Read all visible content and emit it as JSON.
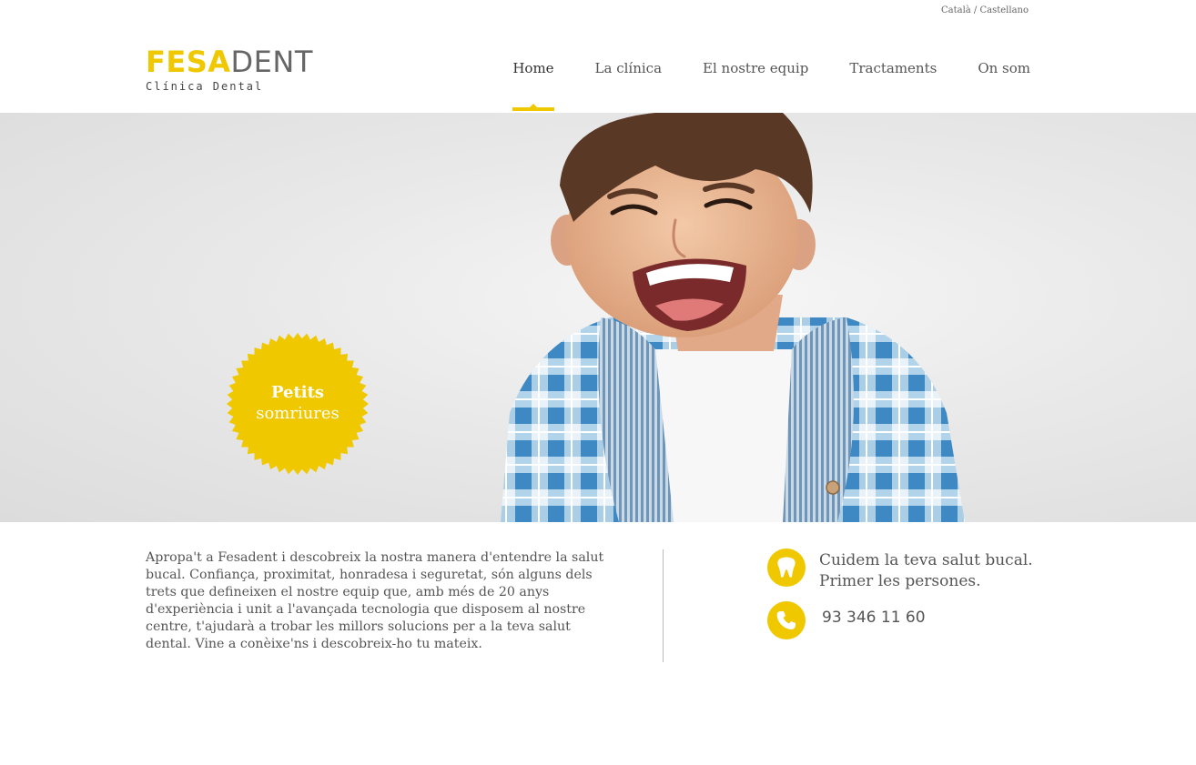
{
  "header": {
    "languages": {
      "catala": "Català",
      "separator": " / ",
      "castellano": "Castellano"
    },
    "logo": {
      "brand_highlight": "FESA",
      "brand_rest": "DENT",
      "subtitle": "Clínica Dental"
    },
    "nav": [
      {
        "label": "Home",
        "active": true
      },
      {
        "label": "La clínica"
      },
      {
        "label": "El nostre equip"
      },
      {
        "label": "Tractaments"
      },
      {
        "label": "On som"
      }
    ]
  },
  "hero": {
    "badge": {
      "line1": "Petits",
      "line2": "somriures"
    }
  },
  "content": {
    "intro": "Apropa't a Fesadent i descobreix la nostra manera d'entendre la salut bucal. Confiança, proximitat, honradesa i seguretat, són alguns dels trets que defineixen el nostre equip que, amb més de 20 anys d'experiència i unit a l'avançada tecnologia que disposem al nostre centre, t'ajudarà a trobar les millors solucions per a la teva salut dental. Vine a conèixe'ns i descobreix-ho tu mateix.",
    "tagline_line1": "Cuidem la teva salut bucal.",
    "tagline_line2": "Primer les persones.",
    "phone": "93 346 11 60"
  },
  "colors": {
    "accent": "#f0c800",
    "text": "#555555",
    "hero_bg": "#e6e6e6"
  },
  "icons": {
    "service": "tooth-icon",
    "contact": "phone-icon"
  }
}
